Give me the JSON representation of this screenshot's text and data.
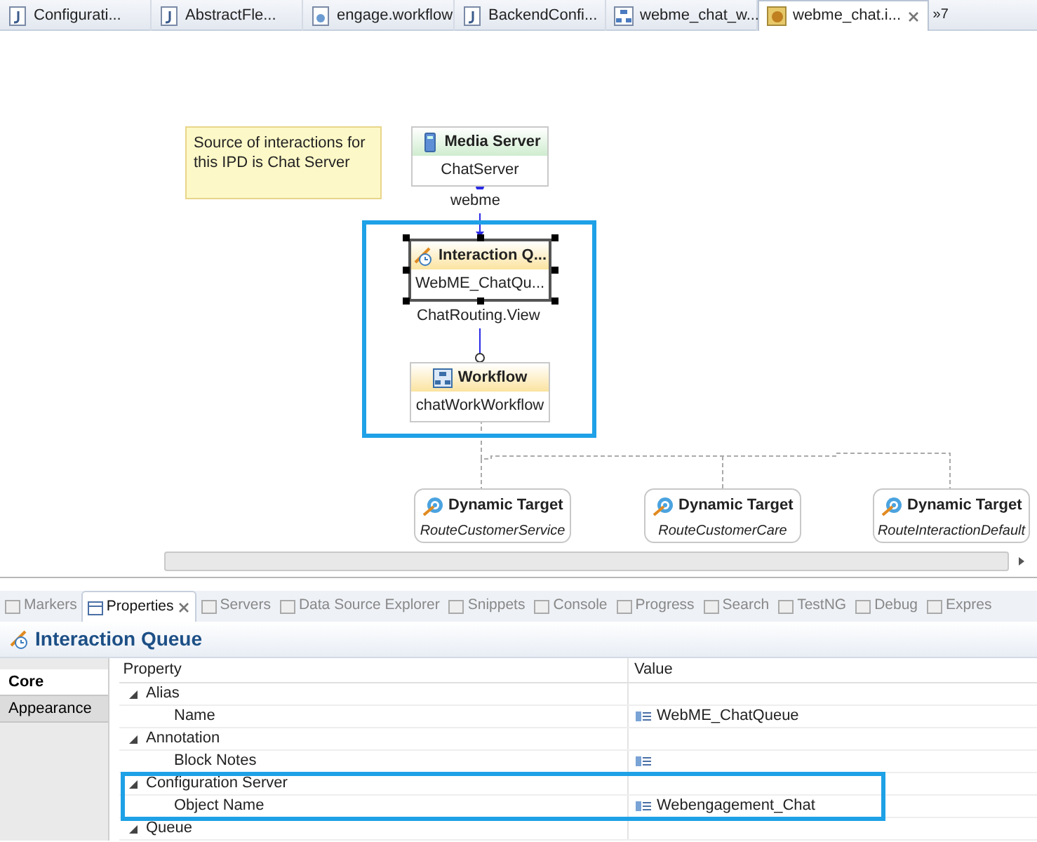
{
  "editor_tabs": [
    {
      "label": "Configurati...",
      "kind": "java",
      "selected": false
    },
    {
      "label": "AbstractFle...",
      "kind": "java",
      "selected": false
    },
    {
      "label": "engage.workflow",
      "kind": "workflow",
      "selected": false
    },
    {
      "label": "BackendConfi...",
      "kind": "java",
      "selected": false
    },
    {
      "label": "webme_chat_w...",
      "kind": "diagram",
      "selected": false
    },
    {
      "label": "webme_chat.i...",
      "kind": "ipd",
      "selected": true
    }
  ],
  "tab_overflow": "»7",
  "diagram": {
    "note": "Source of interactions for this IPD is Chat Server",
    "nodes": [
      {
        "kind": "media_server",
        "title": "Media Server",
        "subtitle": "ChatServer",
        "selected": false
      },
      {
        "kind": "interaction_queue",
        "title": "Interaction Q...",
        "subtitle": "WebME_ChatQu...",
        "selected": true
      },
      {
        "kind": "workflow",
        "title": "Workflow",
        "subtitle": "chatWorkWorkflow",
        "selected": false
      }
    ],
    "edge_labels": [
      "webme",
      "ChatRouting.View"
    ],
    "highlight_box": true,
    "targets": [
      {
        "title": "Dynamic Target",
        "subtitle": "RouteCustomerService"
      },
      {
        "title": "Dynamic Target",
        "subtitle": "RouteCustomerCare"
      },
      {
        "title": "Dynamic Target",
        "subtitle": "RouteInteractionDefault"
      }
    ]
  },
  "view_tabs": [
    {
      "label": "Markers",
      "selected": false
    },
    {
      "label": "Properties",
      "selected": true
    },
    {
      "label": "Servers",
      "selected": false
    },
    {
      "label": "Data Source Explorer",
      "selected": false
    },
    {
      "label": "Snippets",
      "selected": false
    },
    {
      "label": "Console",
      "selected": false
    },
    {
      "label": "Progress",
      "selected": false
    },
    {
      "label": "Search",
      "selected": false
    },
    {
      "label": "TestNG",
      "selected": false
    },
    {
      "label": "Debug",
      "selected": false
    },
    {
      "label": "Expres",
      "selected": false
    }
  ],
  "properties": {
    "title": "Interaction Queue",
    "side_tabs": [
      {
        "label": "Core",
        "selected": true
      },
      {
        "label": "Appearance",
        "selected": false
      }
    ],
    "columns": [
      "Property",
      "Value"
    ],
    "rows": [
      {
        "label": "Alias",
        "expanded": true,
        "highlighted": false,
        "children": [
          {
            "label": "Name",
            "value": "WebME_ChatQueue"
          }
        ]
      },
      {
        "label": "Annotation",
        "expanded": true,
        "highlighted": false,
        "children": [
          {
            "label": "Block Notes"
          }
        ]
      },
      {
        "label": "Configuration Server",
        "expanded": true,
        "highlighted": true,
        "children": [
          {
            "label": "Object Name",
            "value": "Webengagement_Chat"
          }
        ]
      },
      {
        "label": "Queue",
        "expanded": true,
        "highlighted": false,
        "children": []
      }
    ]
  }
}
